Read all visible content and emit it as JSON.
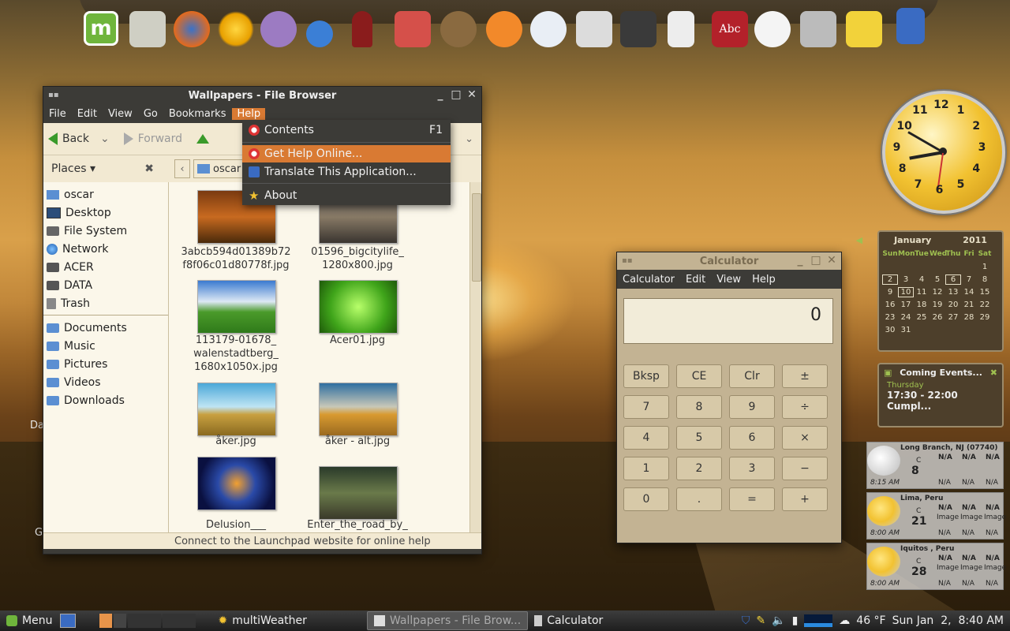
{
  "colors": {
    "accent": "#d97a33",
    "window_bg": "#3c3b37",
    "calc_bg": "#c3b393"
  },
  "dock": {
    "icons": [
      "mint-menu-icon",
      "folder-icon",
      "firefox-icon",
      "sun-icon",
      "pidgin-icon",
      "network-icon",
      "wine-icon",
      "radio-icon",
      "horse-icon",
      "bird-icon",
      "chart-icon",
      "printer-icon",
      "camera-icon",
      "calculator-icon",
      "dictionary-icon",
      "screenshot-icon",
      "camera2-icon",
      "notes-icon",
      "usb-icon"
    ],
    "dict_label": "Abc"
  },
  "file_browser": {
    "title": "Wallpapers - File Browser",
    "menu": [
      "File",
      "Edit",
      "View",
      "Go",
      "Bookmarks",
      "Help"
    ],
    "toolbar": {
      "back": "Back",
      "forward": "Forward"
    },
    "places_label": "Places",
    "location": "oscar",
    "places": [
      {
        "label": "oscar",
        "icon": "home-icon"
      },
      {
        "label": "Desktop",
        "icon": "desktop-icon"
      },
      {
        "label": "File System",
        "icon": "filesystem-icon"
      },
      {
        "label": "Network",
        "icon": "network-icon"
      },
      {
        "label": "ACER",
        "icon": "drive-icon"
      },
      {
        "label": "DATA",
        "icon": "drive-icon"
      },
      {
        "label": "Trash",
        "icon": "trash-icon"
      }
    ],
    "bookmarks": [
      "Documents",
      "Music",
      "Pictures",
      "Videos",
      "Downloads"
    ],
    "files": [
      {
        "name": "3abcb594d01389b72\nf8f06c01d80778f.jpg"
      },
      {
        "name": "01596_bigcitylife_\n1280x800.jpg"
      },
      {
        "name": "113179-01678_\nwalenstadtberg_\n1680x1050x.jpg"
      },
      {
        "name": "Acer01.jpg"
      },
      {
        "name": "åker.jpg"
      },
      {
        "name": "åker - alt.jpg"
      },
      {
        "name": "Delusion___"
      },
      {
        "name": "Enter_the_road_by_"
      }
    ],
    "status": "Connect to the Launchpad website for online help"
  },
  "help_menu": {
    "items": [
      {
        "label": "Contents",
        "accel": "F1"
      },
      {
        "label": "Get Help Online..."
      },
      {
        "label": "Translate This Application..."
      },
      {
        "label": "About"
      }
    ]
  },
  "calculator": {
    "title": "Calculator",
    "menu": [
      "Calculator",
      "Edit",
      "View",
      "Help"
    ],
    "display": "0",
    "buttons": [
      [
        "Bksp",
        "CE",
        "Clr",
        "±"
      ],
      [
        "7",
        "8",
        "9",
        "÷"
      ],
      [
        "4",
        "5",
        "6",
        "×"
      ],
      [
        "1",
        "2",
        "3",
        "−"
      ],
      [
        "0",
        ".",
        "=",
        "+"
      ]
    ]
  },
  "clock": {
    "numbers": [
      "12",
      "1",
      "2",
      "3",
      "4",
      "5",
      "6",
      "7",
      "8",
      "9",
      "10",
      "11"
    ]
  },
  "calendar": {
    "month": "January",
    "year": "2011",
    "weekdays": [
      "Sun",
      "Mon",
      "Tue",
      "Wed",
      "Thu",
      "Fri",
      "Sat"
    ],
    "weeks": [
      [
        "",
        "",
        "",
        "",
        "",
        "",
        "1"
      ],
      [
        "2",
        "3",
        "4",
        "5",
        "6",
        "7",
        "8"
      ],
      [
        "9",
        "10",
        "11",
        "12",
        "13",
        "14",
        "15"
      ],
      [
        "16",
        "17",
        "18",
        "19",
        "20",
        "21",
        "22"
      ],
      [
        "23",
        "24",
        "25",
        "26",
        "27",
        "28",
        "29"
      ],
      [
        "30",
        "31",
        "",
        "",
        "",
        "",
        ""
      ]
    ]
  },
  "events": {
    "title": "Coming Events...",
    "day": "Thursday",
    "event": "17:30 - 22:00 Cumpl..."
  },
  "weather": [
    {
      "location": "Long Branch, NJ (07740)",
      "temp": "8",
      "unit": "C",
      "time": "8:15 AM",
      "na": "N/A"
    },
    {
      "location": "Lima, Peru",
      "temp": "21",
      "unit": "C",
      "time": "8:00 AM",
      "na": "N/A",
      "image": "Image"
    },
    {
      "location": "Iquitos , Peru",
      "temp": "28",
      "unit": "C",
      "time": "8:00 AM",
      "na": "N/A",
      "image": "Image"
    }
  ],
  "desktop_fragments": {
    "left1": "Da",
    "left2": "G",
    "left3": "G"
  },
  "taskbar": {
    "menu": "Menu",
    "tasks": [
      "multiWeather",
      "Wallpapers - File Brow...",
      "Calculator"
    ],
    "temp": "46 °F",
    "datetime": "Sun Jan  2,  8:40 AM"
  }
}
